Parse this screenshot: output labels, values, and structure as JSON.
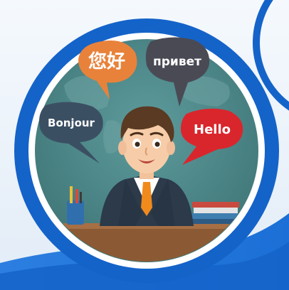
{
  "speech_bubbles": {
    "chinese": {
      "text": "您好",
      "color": "#e8823a"
    },
    "russian": {
      "text": "привет",
      "color": "#4a4a55"
    },
    "french": {
      "text": "Bonjour",
      "color": "#3b4f63"
    },
    "english": {
      "text": "Hello",
      "color": "#d9262c"
    }
  },
  "colors": {
    "ring_blue": "#1463c9",
    "ring_white": "#ffffff",
    "background_teal": "#4f8a8b",
    "desk_brown": "#8b5a34",
    "suit_dark": "#2c3a4a",
    "tie_orange": "#f08a1c"
  }
}
